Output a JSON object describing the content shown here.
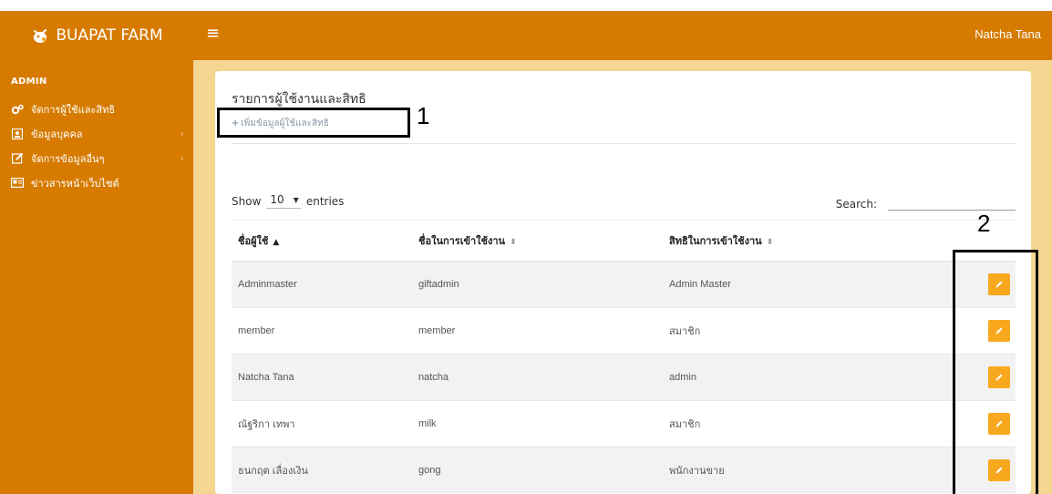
{
  "brand": {
    "name": "BUAPAT FARM",
    "logo_icon": "farm-logo-icon"
  },
  "topbar": {
    "user_name": "Natcha Tana",
    "menu_icon": "hamburger-icon"
  },
  "sidebar": {
    "header": "ADMIN",
    "items": [
      {
        "label": "จัดการผู้ใช้และสิทธิ",
        "icon": "cogs-icon",
        "has_children": false,
        "active": true
      },
      {
        "label": "ข้อมูลบุคคล",
        "icon": "person-card-icon",
        "has_children": true
      },
      {
        "label": "จัดการข้อมูลอื่นๆ",
        "icon": "edit-icon",
        "has_children": true
      },
      {
        "label": "ข่าวสารหน้าเว็บไซต์",
        "icon": "newspaper-icon",
        "has_children": false
      }
    ]
  },
  "main": {
    "title": "รายการผู้ใช้งานและสิทธิ",
    "add_link": "เพิ่มข้อมูลผู้ใช้และสิทธิ",
    "table_controls": {
      "show_label": "Show",
      "page_length": "10",
      "entries_label": "entries",
      "search_label": "Search:",
      "search_value": ""
    },
    "columns": [
      "ชื่อผู้ใช้",
      "ชื่อในการเข้าใช้งาน",
      "สิทธิในการเข้าใช้งาน"
    ],
    "rows": [
      {
        "name": "Adminmaster",
        "username": "giftadmin",
        "role": "Admin Master"
      },
      {
        "name": "member",
        "username": "member",
        "role": "สมาชิก"
      },
      {
        "name": "Natcha Tana",
        "username": "natcha",
        "role": "admin"
      },
      {
        "name": "ณัฐริกา เทพา",
        "username": "milk",
        "role": "สมาชิก"
      },
      {
        "name": "ธนกฤต เลื่องเงิน",
        "username": "gong",
        "role": "พนักงานขาย"
      }
    ]
  },
  "annotations": {
    "box1_label": "1",
    "box2_label": "2"
  },
  "colors": {
    "primary": "#d67b00",
    "content_bg": "#f5d690",
    "edit_button": "#f7a81c"
  }
}
